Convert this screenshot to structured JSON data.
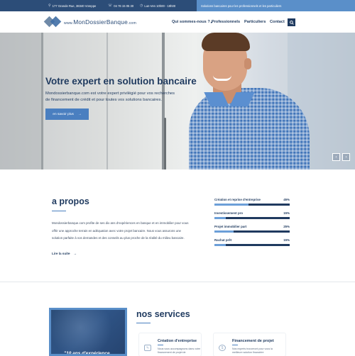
{
  "topbar": {
    "address": "177 Grande Rue, 38340 Voreppe",
    "phone": "04 76 15 05 30",
    "hours": "Lun-Ven 10h00 - 19h00",
    "tagline": "Solutions bancaires pour les professionnels et les particuliers"
  },
  "header": {
    "logo_prefix": "www.",
    "logo_part1": "MonDossier",
    "logo_part2": "Banque",
    "logo_suffix": ".com",
    "nav": [
      "Qui sommes-nous ?",
      "Professionnels",
      "Particuliers",
      "Contact"
    ],
    "search_icon": "search-icon"
  },
  "hero": {
    "title": "Votre expert en solution bancaire",
    "text": "Mondossierbanque.com est votre expert privilégié pour vos recherches de financement de crédit et pour toutes vos solutions bancaires.",
    "cta_label": "en savoir plus",
    "cta_arrow": "→",
    "prev": "‹",
    "next": "›"
  },
  "about": {
    "title": "a propos",
    "text": "Mondossierbanque.com profite de ses dix ans d'expériences en banque et en immobilier pour vous offrir une approche terrain en adéquation avec votre projet bancaire. Nous vous assurons une solution parfaite à vos demandes et des conseils au plus proche de la réalité du milieu bancaire.",
    "link_label": "Lire la suite",
    "link_arrow": "→",
    "skills": [
      {
        "label": "Création et reprise d'entreprise",
        "percent_text": "45%",
        "value": 45
      },
      {
        "label": "Investissement pro",
        "percent_text": "15%",
        "value": 15
      },
      {
        "label": "Projet immobilier part",
        "percent_text": "25%",
        "value": 25
      },
      {
        "label": "Rachat prêt",
        "percent_text": "15%",
        "value": 15
      }
    ]
  },
  "services": {
    "title": "nos services",
    "promo_text": "\"10 ans d'expérience",
    "cards": [
      {
        "title": "Création d'entreprise",
        "text": "Nous vous accompagnons dans votre financement de projet de",
        "icon": "document-icon"
      },
      {
        "title": "Financement de projet",
        "text": "Nos experts trouveront pour vous la meilleure solution financière",
        "icon": "money-bag-icon"
      }
    ]
  },
  "colors": {
    "navy": "#1f3a5f",
    "topbar": "#2c4d78",
    "accent": "#5a8fc9",
    "button": "#4a7fc0",
    "progress_fill": "#6c9fd8"
  }
}
